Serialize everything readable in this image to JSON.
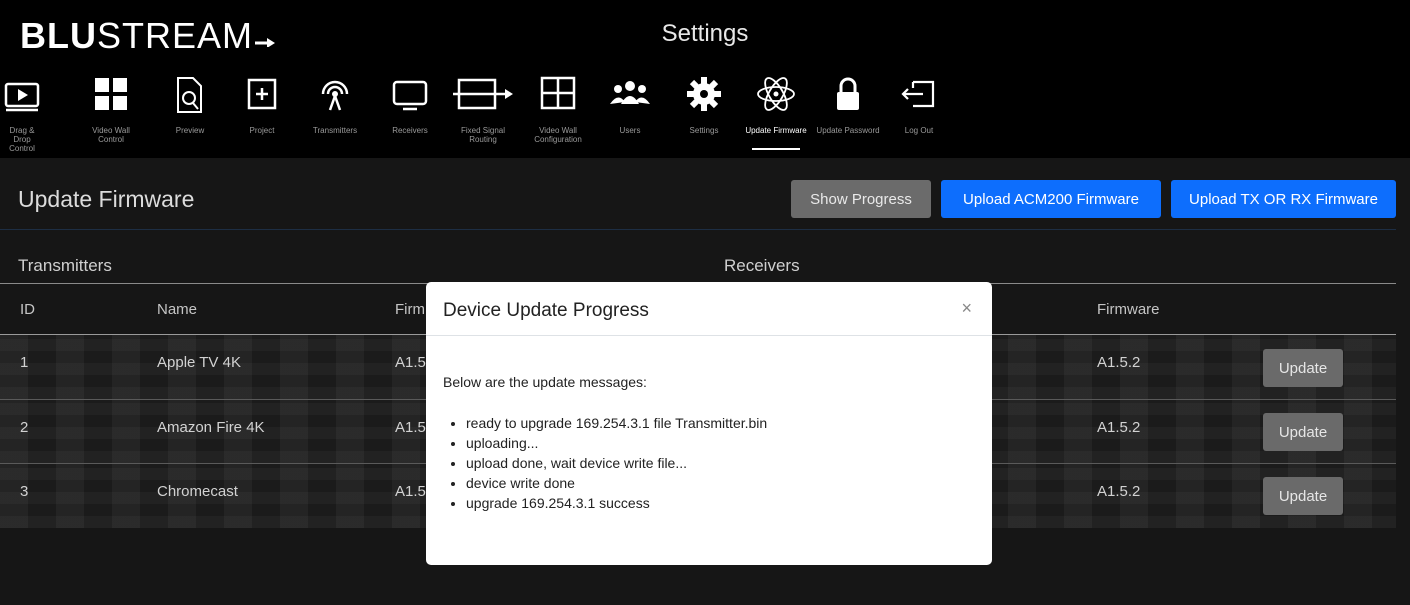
{
  "header": {
    "logo_bold": "BLU",
    "logo_light": "STREAM",
    "title": "Settings"
  },
  "nav": {
    "items": [
      {
        "label": "Drag & Drop Control",
        "icon": "play-screen-icon"
      },
      {
        "label": "Video Wall Control",
        "icon": "video-wall-grid-icon"
      },
      {
        "label": "Preview",
        "icon": "document-search-icon"
      },
      {
        "label": "Project",
        "icon": "plus-box-icon"
      },
      {
        "label": "Transmitters",
        "icon": "antenna-icon"
      },
      {
        "label": "Receivers",
        "icon": "monitor-icon"
      },
      {
        "label": "Fixed Signal Routing",
        "icon": "routing-arrow-icon"
      },
      {
        "label": "Video Wall Configuration",
        "icon": "grid-window-icon"
      },
      {
        "label": "Users",
        "icon": "users-icon"
      },
      {
        "label": "Settings",
        "icon": "gear-icon"
      },
      {
        "label": "Update Firmware",
        "icon": "atom-icon"
      },
      {
        "label": "Update Password",
        "icon": "lock-icon"
      },
      {
        "label": "Log Out",
        "icon": "logout-icon"
      }
    ],
    "active": "Update Firmware"
  },
  "page": {
    "title": "Update Firmware",
    "buttons": {
      "show_progress": "Show Progress",
      "upload_acm": "Upload ACM200 Firmware",
      "upload_txrx": "Upload TX OR RX Firmware"
    }
  },
  "transmitters": {
    "title": "Transmitters",
    "columns": {
      "id": "ID",
      "name": "Name",
      "firmware": "Firm"
    },
    "rows": [
      {
        "id": "1",
        "name": "Apple TV 4K",
        "firmware": "A1.5"
      },
      {
        "id": "2",
        "name": "Amazon Fire 4K",
        "firmware": "A1.5"
      },
      {
        "id": "3",
        "name": "Chromecast",
        "firmware": "A1.5"
      }
    ]
  },
  "receivers": {
    "title": "Receivers",
    "columns": {
      "firmware": "Firmware"
    },
    "rows": [
      {
        "firmware": "A1.5.2",
        "action": "Update"
      },
      {
        "firmware": "A1.5.2",
        "action": "Update"
      },
      {
        "firmware": "A1.5.2",
        "action": "Update"
      }
    ]
  },
  "modal": {
    "title": "Device Update Progress",
    "close": "×",
    "intro": "Below are the update messages:",
    "messages": [
      "ready to upgrade 169.254.3.1 file Transmitter.bin",
      "uploading...",
      "upload done, wait device write file...",
      "device write done",
      "upgrade 169.254.3.1 success"
    ]
  },
  "colors": {
    "accent": "#0d6efd",
    "background": "#161616",
    "topbar": "#000000"
  }
}
